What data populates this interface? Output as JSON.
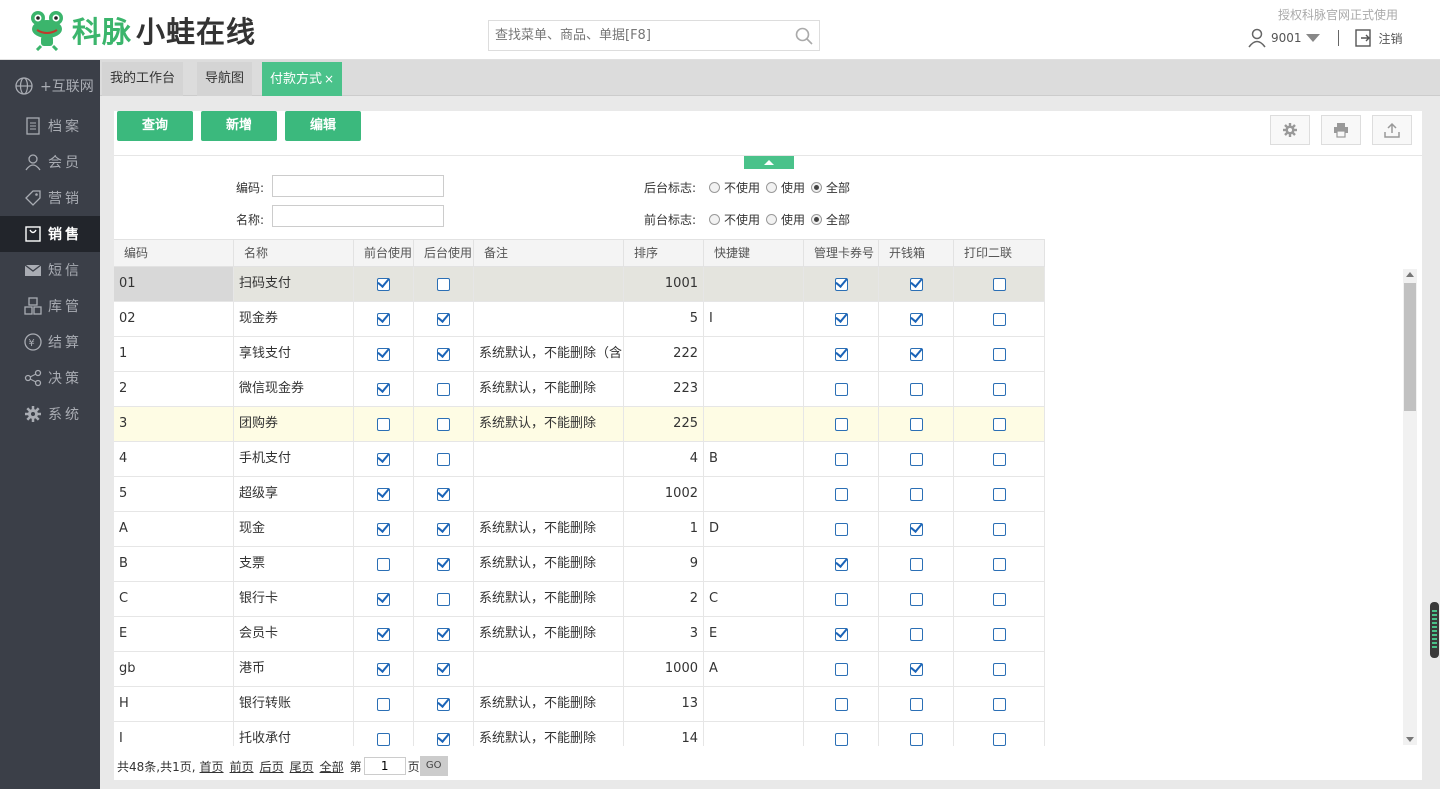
{
  "header": {
    "logo_green": "科脉",
    "logo_dark": "小蛙在线",
    "search_placeholder": "查找菜单、商品、单据[F8]",
    "auth_text": "授权科脉官网正式使用",
    "user": "9001",
    "logout": "注销"
  },
  "sidebar": {
    "items": [
      {
        "label": "+互联网",
        "icon": "globe-icon"
      },
      {
        "label": "档案",
        "icon": "file-icon"
      },
      {
        "label": "会员",
        "icon": "user-icon"
      },
      {
        "label": "营销",
        "icon": "tag-icon"
      },
      {
        "label": "销售",
        "icon": "bag-icon"
      },
      {
        "label": "短信",
        "icon": "mail-icon"
      },
      {
        "label": "库管",
        "icon": "boxes-icon"
      },
      {
        "label": "结算",
        "icon": "yen-icon"
      },
      {
        "label": "决策",
        "icon": "share-icon"
      },
      {
        "label": "系统",
        "icon": "gear-icon"
      }
    ],
    "active": "销售"
  },
  "tabs": [
    {
      "label": "我的工作台"
    },
    {
      "label": "导航图"
    },
    {
      "label": "付款方式",
      "close": "×"
    }
  ],
  "toolbar": {
    "query": "查询",
    "add": "新增",
    "edit": "编辑"
  },
  "filters": {
    "code_label": "编码:",
    "name_label": "名称:",
    "backend_label": "后台标志:",
    "frontend_label": "前台标志:",
    "opt_unused": "不使用",
    "opt_used": "使用",
    "opt_all": "全部"
  },
  "grid": {
    "columns": [
      "编码",
      "名称",
      "前台使用",
      "后台使用",
      "备注",
      "排序",
      "快捷键",
      "管理卡券号",
      "开钱箱",
      "打印二联"
    ],
    "rows": [
      {
        "code": "01",
        "name": "扫码支付",
        "front": true,
        "back": false,
        "note": "",
        "sort": "1001",
        "key": "",
        "card": true,
        "cash": true,
        "print2": false
      },
      {
        "code": "02",
        "name": "现金券",
        "front": true,
        "back": true,
        "note": "",
        "sort": "5",
        "key": "I",
        "card": true,
        "cash": true,
        "print2": false
      },
      {
        "code": "1",
        "name": "享钱支付",
        "front": true,
        "back": true,
        "note": "系统默认，不能删除（含",
        "sort": "222",
        "key": "",
        "card": true,
        "cash": true,
        "print2": false
      },
      {
        "code": "2",
        "name": "微信现金券",
        "front": true,
        "back": false,
        "note": "系统默认，不能删除",
        "sort": "223",
        "key": "",
        "card": false,
        "cash": false,
        "print2": false
      },
      {
        "code": "3",
        "name": "团购券",
        "front": false,
        "back": false,
        "note": "系统默认，不能删除",
        "sort": "225",
        "key": "",
        "card": false,
        "cash": false,
        "print2": false
      },
      {
        "code": "4",
        "name": "手机支付",
        "front": true,
        "back": false,
        "note": "",
        "sort": "4",
        "key": "B",
        "card": false,
        "cash": false,
        "print2": false
      },
      {
        "code": "5",
        "name": "超级享",
        "front": true,
        "back": true,
        "note": "",
        "sort": "1002",
        "key": "",
        "card": false,
        "cash": false,
        "print2": false
      },
      {
        "code": "A",
        "name": "现金",
        "front": true,
        "back": true,
        "note": "系统默认，不能删除",
        "sort": "1",
        "key": "D",
        "card": false,
        "cash": true,
        "print2": false
      },
      {
        "code": "B",
        "name": "支票",
        "front": false,
        "back": true,
        "note": "系统默认，不能删除",
        "sort": "9",
        "key": "",
        "card": true,
        "cash": false,
        "print2": false
      },
      {
        "code": "C",
        "name": "银行卡",
        "front": true,
        "back": false,
        "note": "系统默认，不能删除",
        "sort": "2",
        "key": "C",
        "card": false,
        "cash": false,
        "print2": false
      },
      {
        "code": "E",
        "name": "会员卡",
        "front": true,
        "back": true,
        "note": "系统默认，不能删除",
        "sort": "3",
        "key": "E",
        "card": true,
        "cash": false,
        "print2": false
      },
      {
        "code": "gb",
        "name": "港币",
        "front": true,
        "back": true,
        "note": "",
        "sort": "1000",
        "key": "A",
        "card": false,
        "cash": true,
        "print2": false
      },
      {
        "code": "H",
        "name": "银行转账",
        "front": false,
        "back": true,
        "note": "系统默认，不能删除",
        "sort": "13",
        "key": "",
        "card": false,
        "cash": false,
        "print2": false
      },
      {
        "code": "I",
        "name": "托收承付",
        "front": false,
        "back": true,
        "note": "系统默认，不能删除",
        "sort": "14",
        "key": "",
        "card": false,
        "cash": false,
        "print2": false
      }
    ]
  },
  "pager": {
    "summary": "共48条,共1页,",
    "first": "首页",
    "prev": "前页",
    "next": "后页",
    "last": "尾页",
    "all": "全部",
    "page_prefix": "第",
    "page_value": "1",
    "page_suffix": "页",
    "go": "GO"
  }
}
